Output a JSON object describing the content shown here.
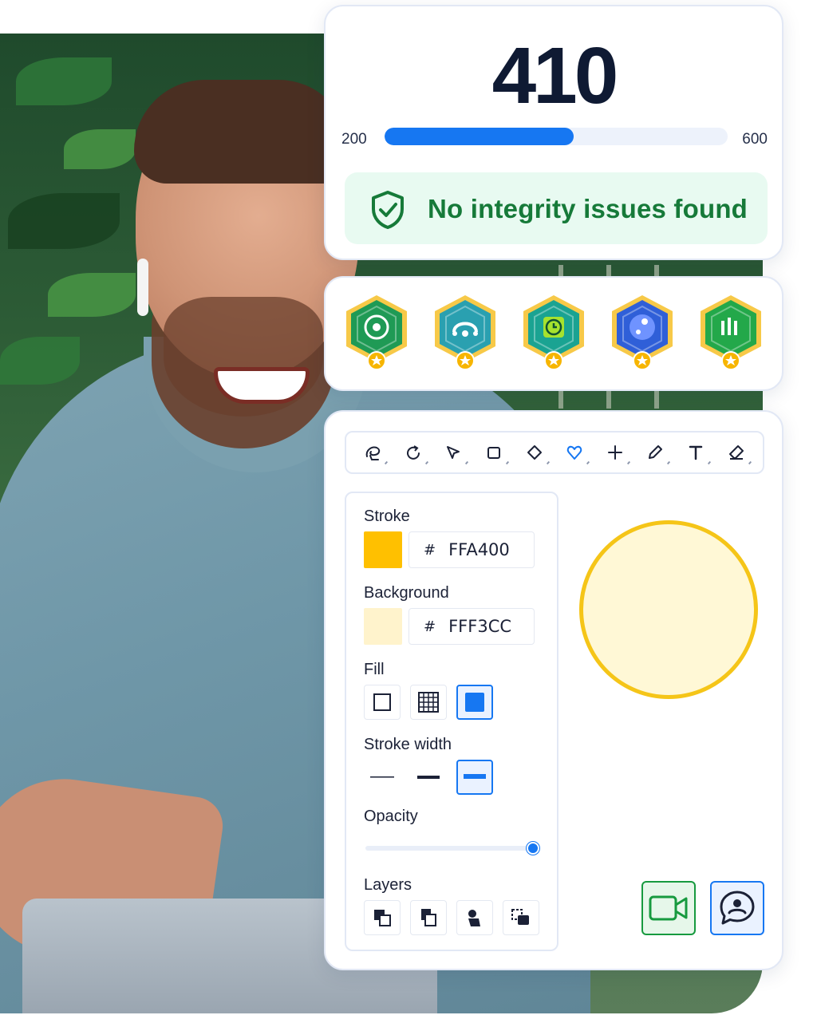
{
  "score": {
    "value": "410",
    "min_label": "200",
    "max_label": "600",
    "progress_fraction": 0.55
  },
  "integrity": {
    "message": "No integrity issues found",
    "icon": "shield-check-icon"
  },
  "badges": [
    {
      "name": "badge-target",
      "icon": "target-icon",
      "color": "#1f9a55"
    },
    {
      "name": "badge-network",
      "icon": "network-icon",
      "color": "#2aa0b0"
    },
    {
      "name": "badge-clock",
      "icon": "clock-icon",
      "color": "#1aa392"
    },
    {
      "name": "badge-molecule",
      "icon": "molecule-icon",
      "color": "#2f5fd8"
    },
    {
      "name": "badge-chart",
      "icon": "bar-chart-icon",
      "color": "#23a84a"
    }
  ],
  "toolbar": {
    "tools": [
      "lasso-icon",
      "rotate-icon",
      "pointer-icon",
      "rectangle-icon",
      "diamond-icon",
      "heart-icon",
      "plus-icon",
      "pencil-icon",
      "text-icon",
      "eraser-icon"
    ],
    "active_tool": "heart-icon"
  },
  "properties": {
    "stroke_label": "Stroke",
    "stroke_hash": "#",
    "stroke_value": "FFA400",
    "stroke_color": "#FFC000",
    "background_label": "Background",
    "background_hash": "#",
    "background_value": "FFF3CC",
    "background_color": "#FFF3CC",
    "fill_label": "Fill",
    "fill_options": [
      "fill-none",
      "fill-hatch",
      "fill-solid"
    ],
    "fill_selected": "fill-solid",
    "stroke_width_label": "Stroke width",
    "stroke_width_options": [
      "thin",
      "medium",
      "thick"
    ],
    "stroke_width_selected": "thick",
    "opacity_label": "Opacity",
    "opacity_value": 1.0,
    "layers_label": "Layers",
    "layer_actions": [
      "send-to-back-icon",
      "send-backward-icon",
      "bring-forward-icon",
      "bring-to-front-icon"
    ]
  },
  "preview": {
    "stroke_color": "#F5C518",
    "fill_color": "#FFF8D6"
  },
  "actions": {
    "video_icon": "video-camera-icon",
    "chat_icon": "chat-user-icon"
  },
  "colors": {
    "accent": "#1677F2",
    "success": "#167A39",
    "success_bg": "#E8FAF1"
  }
}
